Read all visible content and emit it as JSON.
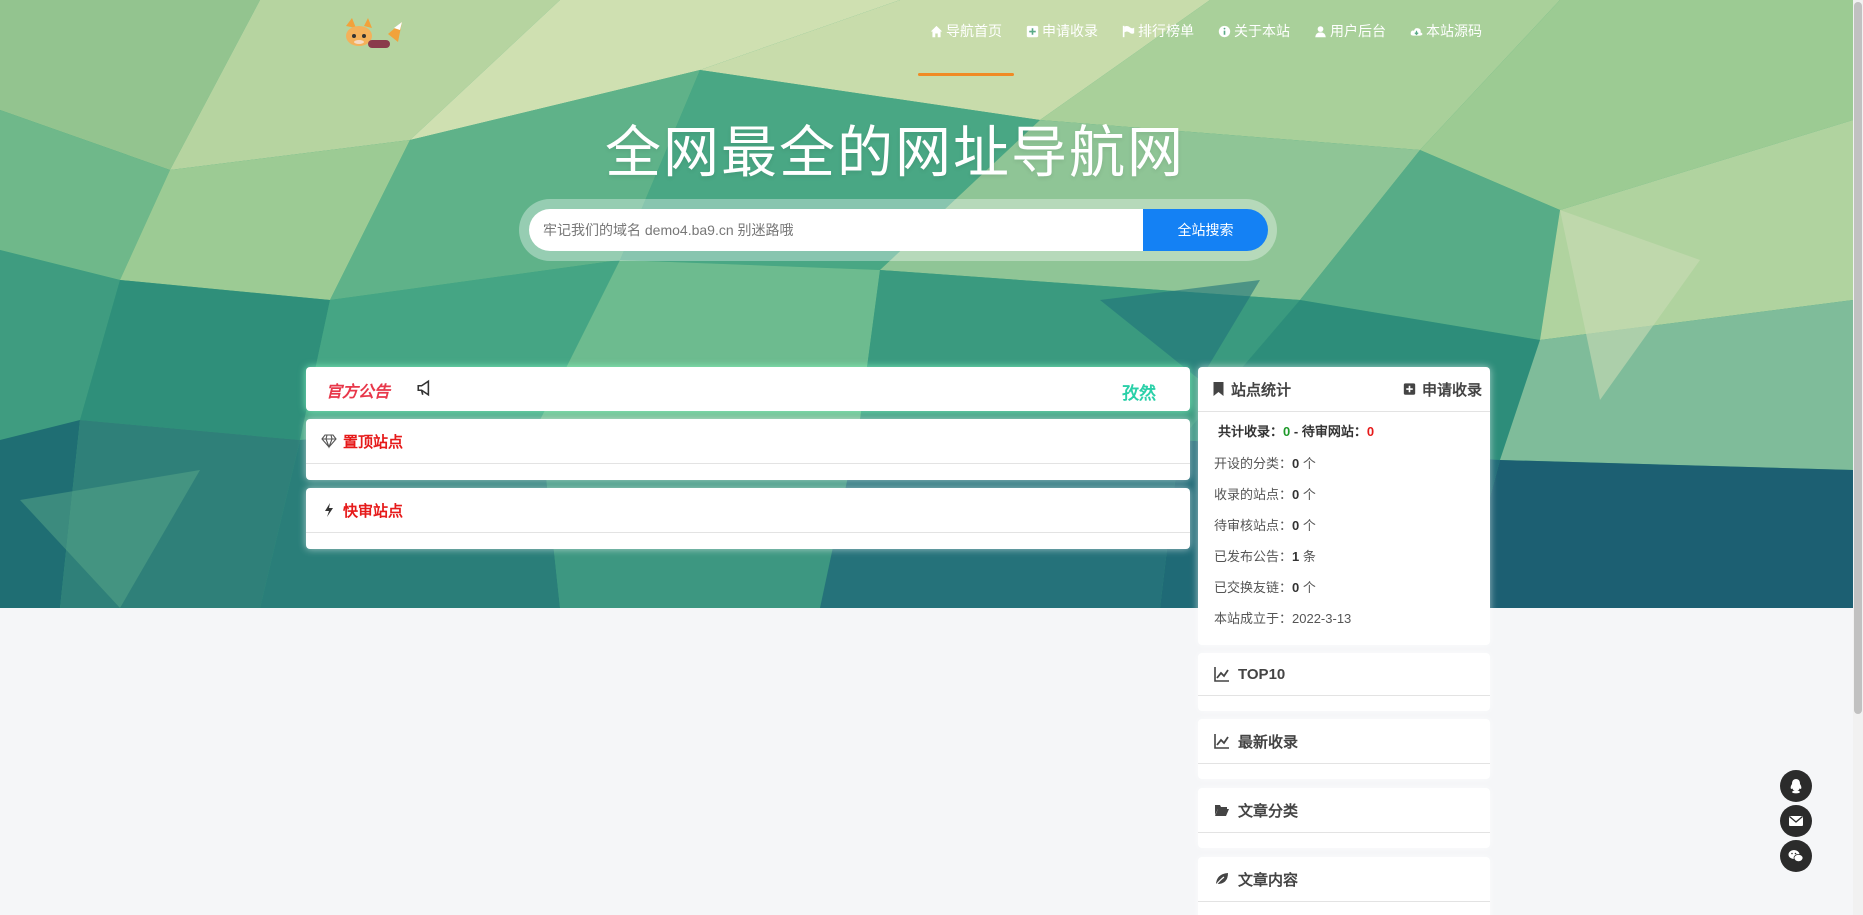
{
  "nav": {
    "items": [
      {
        "label": "导航首页",
        "icon": "home-icon",
        "active": true
      },
      {
        "label": "申请收录",
        "icon": "plus-square-icon"
      },
      {
        "label": "排行榜单",
        "icon": "flag-icon"
      },
      {
        "label": "关于本站",
        "icon": "info-circle-icon"
      },
      {
        "label": "用户后台",
        "icon": "user-icon"
      },
      {
        "label": "本站源码",
        "icon": "cloud-download-icon"
      }
    ]
  },
  "hero": {
    "title": "全网最全的网址导航网"
  },
  "search": {
    "placeholder": "牢记我们的域名 demo4.ba9.cn 别迷路哦",
    "button": "全站搜索"
  },
  "notice": {
    "label": "官方公告",
    "scroll_text": "孜然"
  },
  "sections": {
    "pinned": "置顶站点",
    "fast_review": "快审站点"
  },
  "stats": {
    "title": "站点统计",
    "apply": "申请收录",
    "total_label": "共计收录：",
    "total_value": "0",
    "sep": " - ",
    "pending_label": "待审网站：",
    "pending_value": "0",
    "rows": [
      {
        "label": "开设的分类：",
        "value": "0",
        "unit": " 个"
      },
      {
        "label": "收录的站点：",
        "value": "0",
        "unit": " 个"
      },
      {
        "label": "待审核站点：",
        "value": "0",
        "unit": " 个"
      },
      {
        "label": "已发布公告：",
        "value": "1",
        "unit": " 条"
      },
      {
        "label": "已交换友链：",
        "value": "0",
        "unit": " 个"
      },
      {
        "label": "本站成立于：",
        "value": "2022-3-13",
        "unit": ""
      }
    ]
  },
  "right_panels": {
    "top10": "TOP10",
    "latest": "最新收录",
    "article_category": "文章分类",
    "article_content": "文章内容"
  },
  "colors": {
    "accent": "#1481f4",
    "nav_active_underline": "#f08a24",
    "notice_red": "#e8374a",
    "section_red": "#e61a1a",
    "stat_green": "#1f9a2b"
  }
}
